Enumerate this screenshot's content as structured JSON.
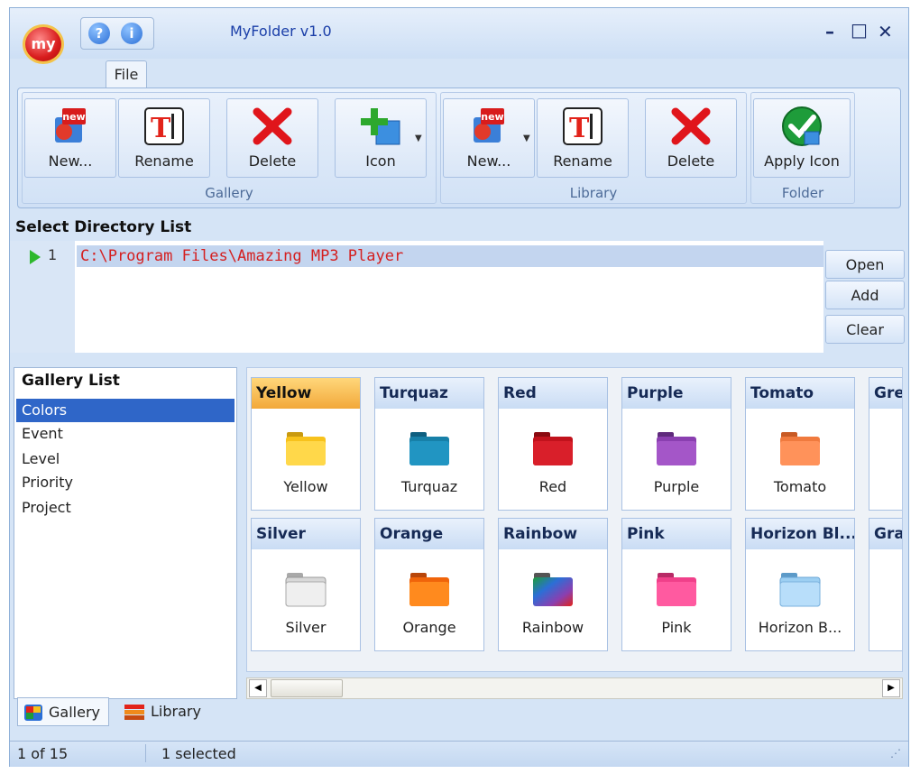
{
  "app": {
    "title": "MyFolder v1.0",
    "logo_text": "my",
    "help_icons": [
      "help-icon",
      "info-icon"
    ],
    "window_controls": [
      "minimize",
      "maximize",
      "close"
    ]
  },
  "ribbon": {
    "tab": "File",
    "groups": [
      {
        "label": "Gallery",
        "buttons": [
          {
            "label": "New...",
            "icon": "new-icon"
          },
          {
            "label": "Rename",
            "icon": "rename-icon"
          },
          {
            "label": "Delete",
            "icon": "delete-icon"
          },
          {
            "label": "Icon",
            "icon": "add-icon-icon"
          }
        ]
      },
      {
        "label": "Library",
        "buttons": [
          {
            "label": "New...",
            "icon": "new-icon"
          },
          {
            "label": "Rename",
            "icon": "rename-icon"
          },
          {
            "label": "Delete",
            "icon": "delete-icon"
          }
        ]
      },
      {
        "label": "Folder",
        "buttons": [
          {
            "label": "Apply Icon",
            "icon": "apply-icon-icon"
          }
        ]
      }
    ]
  },
  "directory": {
    "title": "Select Directory List",
    "line_number": "1",
    "path": "C:\\Program Files\\Amazing MP3 Player",
    "buttons": {
      "open": "Open",
      "add": "Add",
      "clear": "Clear"
    }
  },
  "gallery_list": {
    "title": "Gallery List",
    "items": [
      "Colors",
      "Event",
      "Level",
      "Priority",
      "Project"
    ],
    "selected": "Colors"
  },
  "gallery": {
    "row1": [
      {
        "header": "Yellow",
        "name": "Yellow",
        "color": "#f7c21c"
      },
      {
        "header": "Turquaz",
        "name": "Turquaz",
        "color": "#1780a8"
      },
      {
        "header": "Red",
        "name": "Red",
        "color": "#c1121c"
      },
      {
        "header": "Purple",
        "name": "Purple",
        "color": "#8a3fb0"
      },
      {
        "header": "Tomato",
        "name": "Tomato",
        "color": "#f07a3e"
      },
      {
        "header": "Gre",
        "name": "",
        "color": "#ffffff"
      }
    ],
    "row2": [
      {
        "header": "Silver",
        "name": "Silver",
        "color": "#d8d8d8"
      },
      {
        "header": "Orange",
        "name": "Orange",
        "color": "#f0640a"
      },
      {
        "header": "Rainbow",
        "name": "Rainbow",
        "color": "#7a3fd0"
      },
      {
        "header": "Pink",
        "name": "Pink",
        "color": "#f0408a"
      },
      {
        "header": "Horizon Bl...",
        "name": "Horizon B...",
        "color": "#9ccff2"
      },
      {
        "header": "Gra",
        "name": "",
        "color": "#ffffff"
      }
    ]
  },
  "bottom_tabs": [
    "Gallery",
    "Library"
  ],
  "status": {
    "position": "1 of 15",
    "selection": "1 selected"
  }
}
